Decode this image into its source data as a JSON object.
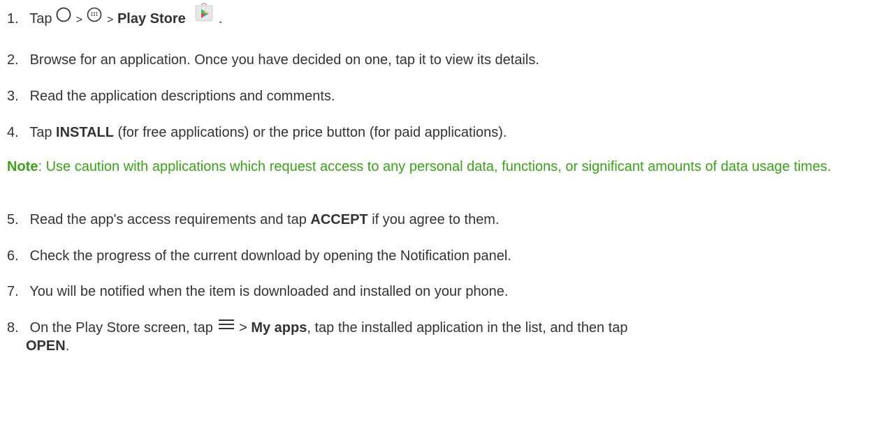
{
  "steps": {
    "s1": {
      "num": "1.",
      "tap": "Tap",
      "sep1": ">",
      "sep2": ">",
      "bold": "Play Store",
      "end": ".",
      "icons": [
        "home-circle-icon",
        "apps-launcher-icon",
        "play-store-icon"
      ]
    },
    "s2": {
      "num": "2.",
      "text": "Browse for an application. Once you have decided on one, tap it to view its details."
    },
    "s3": {
      "num": "3.",
      "text": "Read the application descriptions and comments."
    },
    "s4": {
      "num": "4.",
      "pre": "Tap",
      "bold": "INSTALL",
      "post": "(for free applications) or the price button (for paid applications)."
    },
    "note": {
      "label": "Note",
      "text": ": Use caution with applications which request access to any personal data, functions, or significant amounts of data usage times.",
      "color": "#3aa318"
    },
    "s5": {
      "num": "5.",
      "pre": "Read the app's access requirements and tap",
      "bold": "ACCEPT",
      "post": "if you agree to them."
    },
    "s6": {
      "num": "6.",
      "text": "Check the progress of the current download by opening the Notification panel."
    },
    "s7": {
      "num": "7.",
      "text": "You will be notified when the item is downloaded and installed on your phone."
    },
    "s8": {
      "num": "8.",
      "pre": "On the Play Store screen, tap",
      "sep": ">",
      "bold1": "My apps",
      "mid": ", tap the installed application in the list, and then tap",
      "bold2": "OPEN",
      "end": ".",
      "icons": [
        "menu-icon"
      ]
    }
  }
}
